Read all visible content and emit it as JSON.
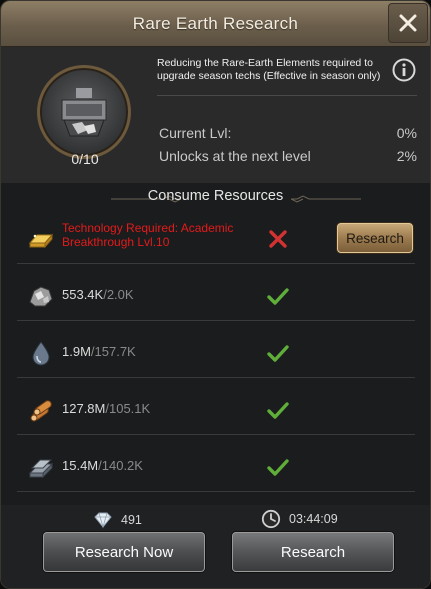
{
  "window": {
    "title": "Rare Earth Research",
    "close_icon": "close-icon"
  },
  "tech": {
    "icon": "rare-earth-machine-icon",
    "progress": "0/10",
    "description": "Reducing the Rare-Earth Elements required to upgrade season techs (Effective in season only)",
    "info_icon": "info-icon",
    "current_label": "Current Lvl:",
    "current_value": "0%",
    "next_label": "Unlocks at the next level",
    "next_value": "2%"
  },
  "resources": {
    "header": "Consume Resources",
    "requirement": {
      "icon": "gold-bar-icon",
      "text": "Technology Required: Academic Breakthrough Lvl.10",
      "status_icon": "red-x-icon",
      "button_label": "Research"
    },
    "items": [
      {
        "icon": "ore-icon",
        "have": "553.4K",
        "need": "/2.0K",
        "status_icon": "check-icon"
      },
      {
        "icon": "oil-drop-icon",
        "have": "1.9M",
        "need": "/157.7K",
        "status_icon": "check-icon"
      },
      {
        "icon": "wood-logs-icon",
        "have": "127.8M",
        "need": "/105.1K",
        "status_icon": "check-icon"
      },
      {
        "icon": "steel-ingot-icon",
        "have": "15.4M",
        "need": "/140.2K",
        "status_icon": "check-icon"
      }
    ]
  },
  "footer": {
    "diamond_icon": "diamond-icon",
    "diamonds": "491",
    "clock_icon": "clock-icon",
    "time": "03:44:09",
    "research_now_label": "Research Now",
    "research_label": "Research"
  },
  "colors": {
    "title_bar": "#7a6c56",
    "requirement_red": "#e31b1b",
    "check_green": "#5fae3a",
    "research_gold": "#a88658"
  }
}
